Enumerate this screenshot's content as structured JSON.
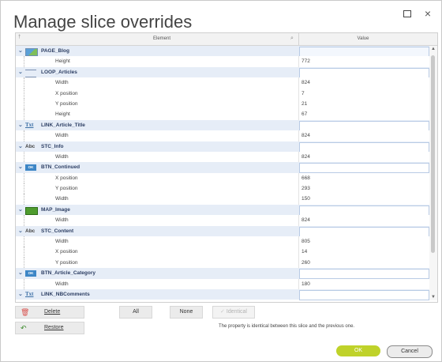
{
  "window": {
    "title": "Manage slice overrides",
    "maximize_icon": "maximize-icon",
    "close_icon": "close-icon",
    "close_glyph": "×"
  },
  "table": {
    "pin_glyph": "†",
    "col_element": "Element",
    "col_value": "Value",
    "search_glyph": "⌕",
    "rows": [
      {
        "kind": "group",
        "icon": "image-icon",
        "name": "PAGE_Blog",
        "highlight": true
      },
      {
        "kind": "prop",
        "name": "Height",
        "value": "772"
      },
      {
        "kind": "group",
        "icon": "loop-icon",
        "name": "LOOP_Articles"
      },
      {
        "kind": "prop",
        "name": "Width",
        "value": "824"
      },
      {
        "kind": "prop",
        "name": "X position",
        "value": "7"
      },
      {
        "kind": "prop",
        "name": "Y position",
        "value": "21"
      },
      {
        "kind": "prop",
        "name": "Height",
        "value": "67"
      },
      {
        "kind": "group",
        "icon": "text-link-icon",
        "icon_text": "Txt",
        "name": "LINK_Article_Title"
      },
      {
        "kind": "prop",
        "name": "Width",
        "value": "824"
      },
      {
        "kind": "group",
        "icon": "static-text-icon",
        "icon_text": "Abc",
        "name": "STC_Info"
      },
      {
        "kind": "prop",
        "name": "Width",
        "value": "824"
      },
      {
        "kind": "group",
        "icon": "button-icon",
        "icon_text": "OK",
        "name": "BTN_Continued"
      },
      {
        "kind": "prop",
        "name": "X position",
        "value": "668"
      },
      {
        "kind": "prop",
        "name": "Y position",
        "value": "293"
      },
      {
        "kind": "prop",
        "name": "Width",
        "value": "150"
      },
      {
        "kind": "group",
        "icon": "map-image-icon",
        "name": "MAP_Image"
      },
      {
        "kind": "prop",
        "name": "Width",
        "value": "824"
      },
      {
        "kind": "group",
        "icon": "static-text-icon",
        "icon_text": "Abc",
        "name": "STC_Content"
      },
      {
        "kind": "prop",
        "name": "Width",
        "value": "805"
      },
      {
        "kind": "prop",
        "name": "X position",
        "value": "14"
      },
      {
        "kind": "prop",
        "name": "Y position",
        "value": "260"
      },
      {
        "kind": "group",
        "icon": "button-icon",
        "icon_text": "OK",
        "name": "BTN_Article_Category"
      },
      {
        "kind": "prop",
        "name": "Width",
        "value": "180"
      },
      {
        "kind": "group",
        "icon": "text-link-icon",
        "icon_text": "Txt",
        "name": "LINK_NBComments"
      }
    ]
  },
  "toolbar": {
    "delete_label": "Delete",
    "delete_icon": "trash-icon",
    "restore_label": "Restore",
    "restore_icon": "undo-arrow-icon",
    "all_label": "All",
    "none_label": "None",
    "identical_label": "Identical",
    "identical_glyph": "✓",
    "hint": "The property is identical between this slice and the previous one."
  },
  "footer": {
    "ok_label": "OK",
    "cancel_label": "Cancel"
  },
  "colors": {
    "ok": "#bfd22a",
    "group_row": "#e6edf7",
    "accent": "#3d86c6"
  }
}
